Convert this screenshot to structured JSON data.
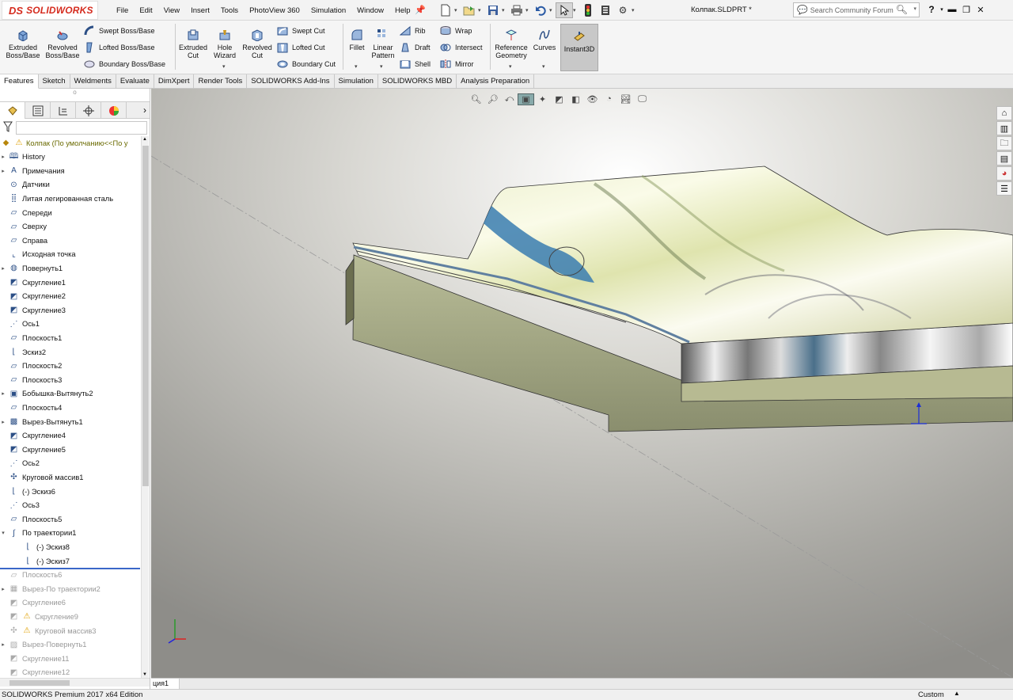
{
  "titlebar": {
    "brand": "SOLIDWORKS",
    "brand_mark": "DS",
    "menu": [
      "File",
      "Edit",
      "View",
      "Insert",
      "Tools",
      "PhotoView 360",
      "Simulation",
      "Window",
      "Help"
    ],
    "doc_title": "Колпак.SLDPRT *",
    "search_placeholder": "Search Community Forum",
    "help_label": "?"
  },
  "features": {
    "extruded_boss": "Extruded Boss/Base",
    "revolved_boss": "Revolved Boss/Base",
    "swept_boss": "Swept Boss/Base",
    "lofted_boss": "Lofted Boss/Base",
    "boundary_boss": "Boundary Boss/Base",
    "extruded_cut": "Extruded Cut",
    "hole_wizard": "Hole Wizard",
    "revolved_cut": "Revolved Cut",
    "swept_cut": "Swept Cut",
    "lofted_cut": "Lofted Cut",
    "boundary_cut": "Boundary Cut",
    "fillet": "Fillet",
    "linear_pattern": "Linear Pattern",
    "rib": "Rib",
    "draft": "Draft",
    "shell": "Shell",
    "wrap": "Wrap",
    "intersect": "Intersect",
    "mirror": "Mirror",
    "reference_geometry": "Reference Geometry",
    "curves": "Curves",
    "instant3d": "Instant3D"
  },
  "tabs": [
    "Features",
    "Sketch",
    "Weldments",
    "Evaluate",
    "DimXpert",
    "Render Tools",
    "SOLIDWORKS Add-Ins",
    "Simulation",
    "SOLIDWORKS MBD",
    "Analysis Preparation"
  ],
  "tree": {
    "root": "Колпак  (По умолчанию<<По у",
    "items": [
      {
        "label": "History",
        "exp": "▸",
        "icon": "history-icon",
        "dim": false
      },
      {
        "label": "Примечания",
        "exp": "▸",
        "icon": "annotations-icon",
        "dim": false
      },
      {
        "label": "Датчики",
        "exp": "",
        "icon": "sensors-icon",
        "dim": false
      },
      {
        "label": "Литая легированная сталь",
        "exp": "",
        "icon": "material-icon",
        "dim": false
      },
      {
        "label": "Спереди",
        "exp": "",
        "icon": "plane-icon",
        "dim": false
      },
      {
        "label": "Сверху",
        "exp": "",
        "icon": "plane-icon",
        "dim": false
      },
      {
        "label": "Справа",
        "exp": "",
        "icon": "plane-icon",
        "dim": false
      },
      {
        "label": "Исходная точка",
        "exp": "",
        "icon": "origin-icon",
        "dim": false
      },
      {
        "label": "Повернуть1",
        "exp": "▸",
        "icon": "revolve-icon",
        "dim": false
      },
      {
        "label": "Скругление1",
        "exp": "",
        "icon": "fillet-icon",
        "dim": false
      },
      {
        "label": "Скругление2",
        "exp": "",
        "icon": "fillet-icon",
        "dim": false
      },
      {
        "label": "Скругление3",
        "exp": "",
        "icon": "fillet-icon",
        "dim": false
      },
      {
        "label": "Ось1",
        "exp": "",
        "icon": "axis-icon",
        "dim": false
      },
      {
        "label": "Плоскость1",
        "exp": "",
        "icon": "plane-icon",
        "dim": false
      },
      {
        "label": "Эскиз2",
        "exp": "",
        "icon": "sketch-icon",
        "dim": false
      },
      {
        "label": "Плоскость2",
        "exp": "",
        "icon": "plane-icon",
        "dim": false
      },
      {
        "label": "Плоскость3",
        "exp": "",
        "icon": "plane-icon",
        "dim": false
      },
      {
        "label": "Бобышка-Вытянуть2",
        "exp": "▸",
        "icon": "extrude-icon",
        "dim": false
      },
      {
        "label": "Плоскость4",
        "exp": "",
        "icon": "plane-icon",
        "dim": false
      },
      {
        "label": "Вырез-Вытянуть1",
        "exp": "▸",
        "icon": "cut-extrude-icon",
        "dim": false
      },
      {
        "label": "Скругление4",
        "exp": "",
        "icon": "fillet-icon",
        "dim": false
      },
      {
        "label": "Скругление5",
        "exp": "",
        "icon": "fillet-icon",
        "dim": false
      },
      {
        "label": "Ось2",
        "exp": "",
        "icon": "axis-icon",
        "dim": false
      },
      {
        "label": "Круговой массив1",
        "exp": "",
        "icon": "circular-pattern-icon",
        "dim": false
      },
      {
        "label": "(-) Эскиз6",
        "exp": "",
        "icon": "sketch-icon",
        "dim": false
      },
      {
        "label": "Ось3",
        "exp": "",
        "icon": "axis-icon",
        "dim": false
      },
      {
        "label": "Плоскость5",
        "exp": "",
        "icon": "plane-icon",
        "dim": false
      },
      {
        "label": "По траектории1",
        "exp": "▾",
        "icon": "sweep-icon",
        "dim": false
      },
      {
        "label": "(-) Эскиз8",
        "exp": "",
        "icon": "sketch-icon",
        "dim": false,
        "indent": true
      },
      {
        "label": "(-) Эскиз7",
        "exp": "",
        "icon": "sketch-icon",
        "dim": false,
        "indent": true
      },
      {
        "label": "Плоскость6",
        "exp": "",
        "icon": "plane-icon",
        "dim": true
      },
      {
        "label": "Вырез-По траектории2",
        "exp": "▸",
        "icon": "cut-sweep-icon",
        "dim": true
      },
      {
        "label": "Скругление6",
        "exp": "",
        "icon": "fillet-icon",
        "dim": true
      },
      {
        "label": "Скругление9",
        "exp": "",
        "icon": "fillet-icon",
        "dim": true,
        "warn": true
      },
      {
        "label": "Круговой массив3",
        "exp": "",
        "icon": "circular-pattern-icon",
        "dim": true,
        "warn": true
      },
      {
        "label": "Вырез-Повернуть1",
        "exp": "▸",
        "icon": "cut-revolve-icon",
        "dim": true
      },
      {
        "label": "Скругление11",
        "exp": "",
        "icon": "fillet-icon",
        "dim": true
      },
      {
        "label": "Скругление12",
        "exp": "",
        "icon": "fillet-icon",
        "dim": true
      }
    ]
  },
  "viewport": {
    "tab_label": "ция1"
  },
  "status": {
    "edition": "SOLIDWORKS Premium 2017 x64 Edition",
    "units": "Custom"
  },
  "colors": {
    "brand_red": "#d52b1e",
    "rollback_bar": "#3a67c8",
    "warning": "#f0b400"
  }
}
